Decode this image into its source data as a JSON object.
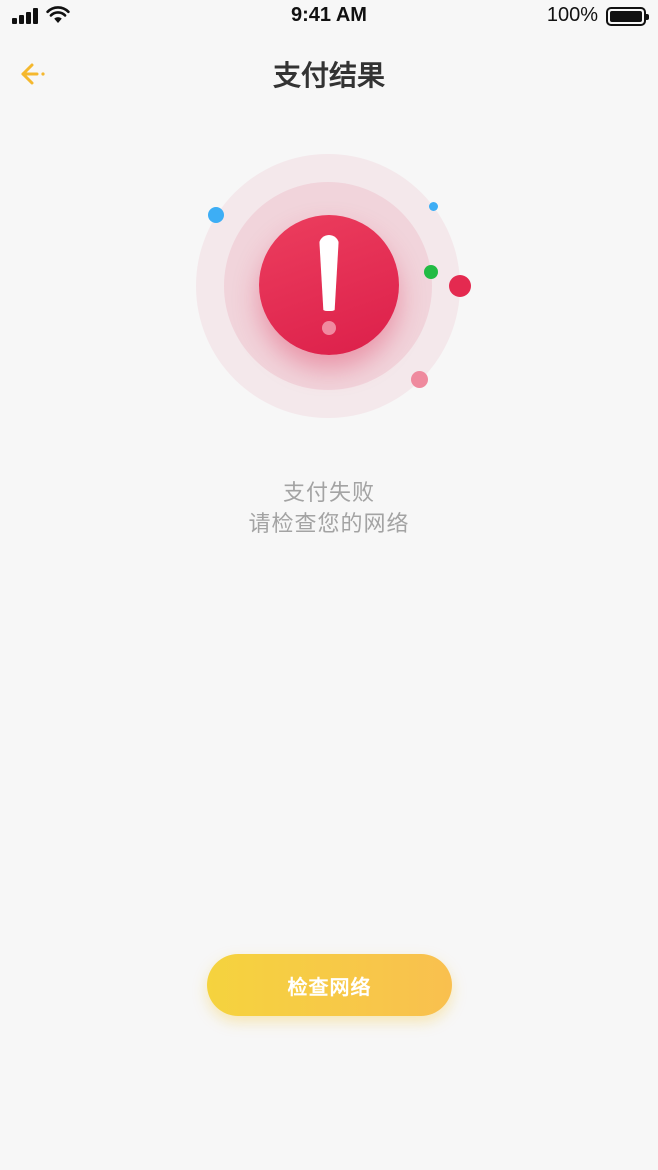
{
  "status_bar": {
    "time": "9:41 AM",
    "battery_percent": "100%",
    "signal_bars": 4,
    "battery_level": 1.0
  },
  "nav": {
    "title": "支付结果",
    "back_icon": "back-arrow-icon",
    "accent_color": "#f5b82e"
  },
  "illustration": {
    "icon": "exclamation-alert-icon",
    "primary_color": "#e0244f"
  },
  "message": {
    "line1": "支付失败",
    "line2": "请检查您的网络"
  },
  "action": {
    "label": "检查网络",
    "gradient": [
      "#f5d33e",
      "#f9c04f"
    ]
  }
}
